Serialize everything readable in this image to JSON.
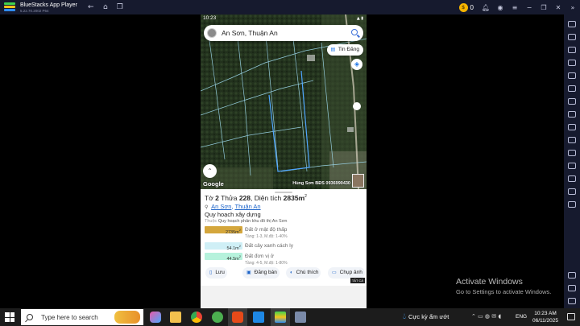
{
  "window": {
    "app_title": "BlueStacks App Player",
    "app_version": "5.22.70.2002 P64",
    "coin_count": "0"
  },
  "phone": {
    "status_time": "10:23",
    "search": {
      "text": "An Sơn, Thuận An"
    },
    "news_button": "Tin Đăng",
    "map_logo": "Google",
    "watermark": "Hùng Sơn BĐS 0936990430",
    "sheet": {
      "title_prefix": "Tờ",
      "sheet_no": "2",
      "plot_prefix": "Thửa",
      "plot_no": "228",
      "area_prefix": ", Diện tích",
      "area_value": "2835m",
      "area_unit_sup": "2",
      "location_part1": "An Sơn",
      "location_sep": ", ",
      "location_part2": "Thuận An",
      "planning_title": "Quy hoạch xây dựng",
      "planning_label": "Thuộc",
      "planning_value": "Quy hoạch phân khu đô thị An Sơn",
      "zones": [
        {
          "area": "2735m",
          "sup": "2",
          "name": "Đất ở mật độ thấp",
          "detail": "Tầng: 1-3, M.độ: 1-40%",
          "color": "#d4a63c"
        },
        {
          "area": "54.1m",
          "sup": "2",
          "name": "Đất cây xanh cách ly",
          "detail": "",
          "color": "#cfeff6"
        },
        {
          "area": "44.5m",
          "sup": "2",
          "name": "Đất đơn vị ở",
          "detail": "Tầng: 4-5, M.độ: 1-80%",
          "color": "#b6f2dc"
        }
      ],
      "actions": [
        {
          "icon": "save-icon",
          "label": "Lưu"
        },
        {
          "icon": "post-icon",
          "label": "Đăng bán"
        },
        {
          "icon": "note-icon",
          "label": "Chú thích"
        },
        {
          "icon": "camera-icon",
          "label": "Chụp ảnh"
        }
      ],
      "all_badge": "TẤT CẢ"
    }
  },
  "windows_notice": {
    "title": "Activate Windows",
    "subtitle": "Go to Settings to activate Windows."
  },
  "taskbar": {
    "search_placeholder": "Type here to search",
    "weather": "Cực kỳ ẩm ướt",
    "language": "ENG",
    "time": "10:23 AM",
    "date": "06/11/2025"
  },
  "colors": {
    "bluestacks_dark": "#161a2e",
    "link_blue": "#1a62c8",
    "taskbar": "#1c1c1c"
  }
}
